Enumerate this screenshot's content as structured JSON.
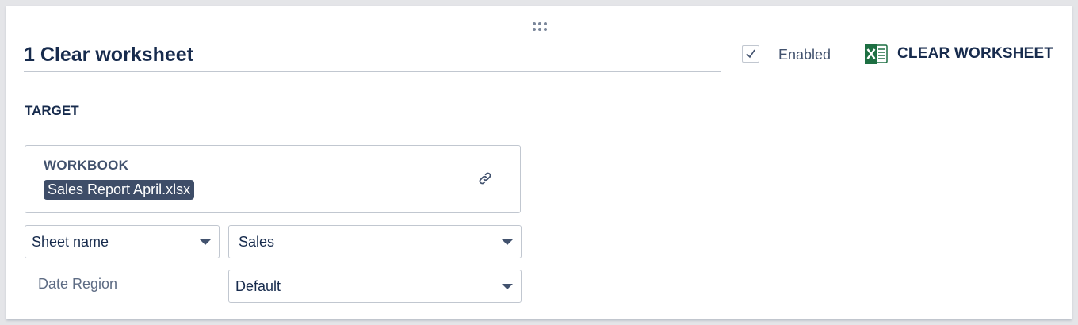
{
  "header": {
    "title": "1 Clear worksheet",
    "enabled_label": "Enabled",
    "enabled_checked": true,
    "action_label": "CLEAR WORKSHEET",
    "action_icon": "excel-icon"
  },
  "target": {
    "section_label": "TARGET",
    "workbook_label": "WORKBOOK",
    "workbook_value": "Sales Report April.xlsx",
    "link_icon": "link-icon"
  },
  "fields": {
    "sheet_mode": "Sheet name",
    "sheet_value": "Sales",
    "date_region_label": "Date Region",
    "date_region_value": "Default"
  },
  "colors": {
    "chip_bg": "#3e4d68",
    "excel_green": "#1d6f42",
    "text_primary": "#172b4d"
  }
}
